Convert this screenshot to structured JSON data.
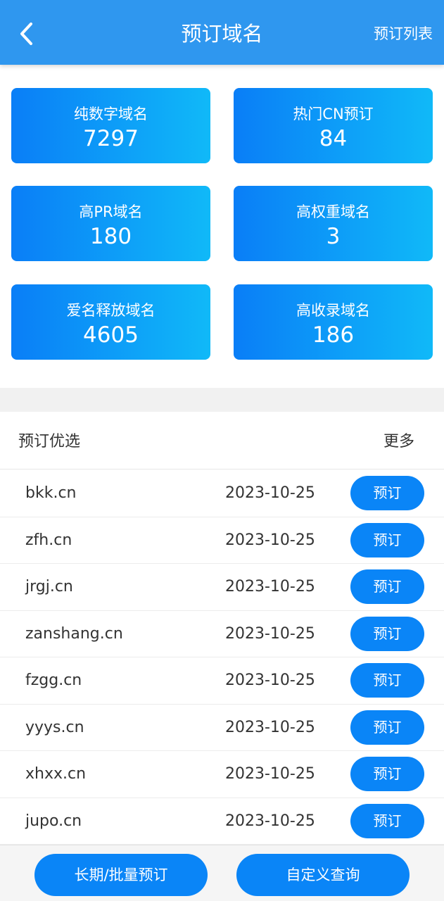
{
  "header": {
    "title": "预订域名",
    "right_link": "预订列表",
    "back_icon": "chevron-left-icon"
  },
  "stats": [
    {
      "label": "纯数字域名",
      "value": "7297"
    },
    {
      "label": "热门CN预订",
      "value": "84"
    },
    {
      "label": "高PR域名",
      "value": "180"
    },
    {
      "label": "高权重域名",
      "value": "3"
    },
    {
      "label": "爱名释放域名",
      "value": "4605"
    },
    {
      "label": "高收录域名",
      "value": "186"
    }
  ],
  "section": {
    "title": "预订优选",
    "more": "更多"
  },
  "domains": [
    {
      "name": "bkk.cn",
      "date": "2023-10-25",
      "action": "预订"
    },
    {
      "name": "zfh.cn",
      "date": "2023-10-25",
      "action": "预订"
    },
    {
      "name": "jrgj.cn",
      "date": "2023-10-25",
      "action": "预订"
    },
    {
      "name": "zanshang.cn",
      "date": "2023-10-25",
      "action": "预订"
    },
    {
      "name": "fzgg.cn",
      "date": "2023-10-25",
      "action": "预订"
    },
    {
      "name": "yyys.cn",
      "date": "2023-10-25",
      "action": "预订"
    },
    {
      "name": "xhxx.cn",
      "date": "2023-10-25",
      "action": "预订"
    },
    {
      "name": "jupo.cn",
      "date": "2023-10-25",
      "action": "预订"
    }
  ],
  "footer": {
    "bulk_button": "长期/批量预订",
    "custom_query_button": "自定义查询"
  },
  "colors": {
    "header_bg": "#2f97ef",
    "card_gradient_start": "#0a7ef7",
    "card_gradient_end": "#10b9f8",
    "button_blue": "#0a85f7"
  }
}
